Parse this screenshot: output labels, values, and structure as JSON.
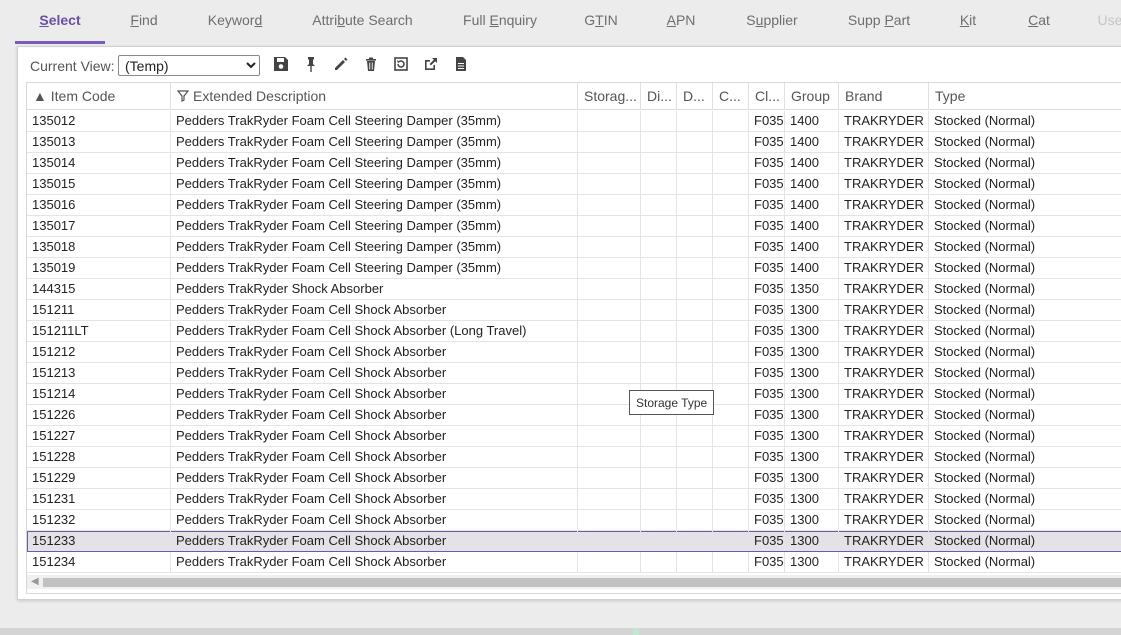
{
  "tabs": [
    {
      "pre": "",
      "acc": "S",
      "post": "elect"
    },
    {
      "pre": "",
      "acc": "F",
      "post": "ind"
    },
    {
      "pre": "Keywor",
      "acc": "d",
      "post": ""
    },
    {
      "pre": "Attri",
      "acc": "b",
      "post": "ute Search"
    },
    {
      "pre": "Full ",
      "acc": "E",
      "post": "nquiry"
    },
    {
      "pre": "G",
      "acc": "T",
      "post": "IN"
    },
    {
      "pre": "",
      "acc": "A",
      "post": "PN"
    },
    {
      "pre": "S",
      "acc": "u",
      "post": "pplier"
    },
    {
      "pre": "Supp ",
      "acc": "P",
      "post": "art"
    },
    {
      "pre": "",
      "acc": "K",
      "post": "it"
    },
    {
      "pre": "",
      "acc": "C",
      "post": "at"
    },
    {
      "pre": "Use",
      "acc": "",
      "post": ""
    }
  ],
  "toolbar": {
    "current_view_label": "Current View:",
    "current_view_value": "(Temp)",
    "icons": [
      "save-icon",
      "pin-icon",
      "edit-icon",
      "delete-icon",
      "reset-icon",
      "export-icon",
      "document-icon"
    ]
  },
  "grid": {
    "columns": [
      {
        "key": "code",
        "label": "Item Code",
        "prefix": "▲ "
      },
      {
        "key": "desc",
        "label": "Extended Description",
        "prefix": "filter"
      },
      {
        "key": "storage",
        "label": "Storag...",
        "prefix": ""
      },
      {
        "key": "di",
        "label": "Di...",
        "prefix": ""
      },
      {
        "key": "d",
        "label": "D...",
        "prefix": ""
      },
      {
        "key": "c",
        "label": "C...",
        "prefix": ""
      },
      {
        "key": "cl",
        "label": "Cl...",
        "prefix": ""
      },
      {
        "key": "group",
        "label": "Group",
        "prefix": ""
      },
      {
        "key": "brand",
        "label": "Brand",
        "prefix": ""
      },
      {
        "key": "type",
        "label": "Type",
        "prefix": ""
      }
    ],
    "rows": [
      {
        "code": "135012",
        "desc": "Pedders TrakRyder Foam Cell Steering Damper (35mm)",
        "cl": "F035",
        "group": "1400",
        "brand": "TRAKRYDER",
        "type": "Stocked (Normal)"
      },
      {
        "code": "135013",
        "desc": "Pedders TrakRyder Foam Cell Steering Damper (35mm)",
        "cl": "F035",
        "group": "1400",
        "brand": "TRAKRYDER",
        "type": "Stocked (Normal)"
      },
      {
        "code": "135014",
        "desc": "Pedders TrakRyder Foam Cell Steering Damper (35mm)",
        "cl": "F035",
        "group": "1400",
        "brand": "TRAKRYDER",
        "type": "Stocked (Normal)"
      },
      {
        "code": "135015",
        "desc": "Pedders TrakRyder Foam Cell Steering Damper (35mm)",
        "cl": "F035",
        "group": "1400",
        "brand": "TRAKRYDER",
        "type": "Stocked (Normal)"
      },
      {
        "code": "135016",
        "desc": "Pedders TrakRyder Foam Cell Steering Damper (35mm)",
        "cl": "F035",
        "group": "1400",
        "brand": "TRAKRYDER",
        "type": "Stocked (Normal)"
      },
      {
        "code": "135017",
        "desc": "Pedders TrakRyder Foam Cell Steering Damper (35mm)",
        "cl": "F035",
        "group": "1400",
        "brand": "TRAKRYDER",
        "type": "Stocked (Normal)"
      },
      {
        "code": "135018",
        "desc": "Pedders TrakRyder Foam Cell Steering Damper (35mm)",
        "cl": "F035",
        "group": "1400",
        "brand": "TRAKRYDER",
        "type": "Stocked (Normal)"
      },
      {
        "code": "135019",
        "desc": "Pedders TrakRyder Foam Cell Steering Damper (35mm)",
        "cl": "F035",
        "group": "1400",
        "brand": "TRAKRYDER",
        "type": "Stocked (Normal)"
      },
      {
        "code": "144315",
        "desc": "Pedders TrakRyder Shock Absorber",
        "cl": "F035",
        "group": "1350",
        "brand": "TRAKRYDER",
        "type": "Stocked (Normal)"
      },
      {
        "code": "151211",
        "desc": "Pedders TrakRyder Foam Cell Shock Absorber",
        "cl": "F035",
        "group": "1300",
        "brand": "TRAKRYDER",
        "type": "Stocked (Normal)"
      },
      {
        "code": "151211LT",
        "desc": "Pedders TrakRyder Foam Cell Shock Absorber (Long Travel)",
        "cl": "F035",
        "group": "1300",
        "brand": "TRAKRYDER",
        "type": "Stocked (Normal)"
      },
      {
        "code": "151212",
        "desc": "Pedders TrakRyder Foam Cell Shock Absorber",
        "cl": "F035",
        "group": "1300",
        "brand": "TRAKRYDER",
        "type": "Stocked (Normal)"
      },
      {
        "code": "151213",
        "desc": "Pedders TrakRyder Foam Cell Shock Absorber",
        "cl": "F035",
        "group": "1300",
        "brand": "TRAKRYDER",
        "type": "Stocked (Normal)"
      },
      {
        "code": "151214",
        "desc": "Pedders TrakRyder Foam Cell Shock Absorber",
        "cl": "F035",
        "group": "1300",
        "brand": "TRAKRYDER",
        "type": "Stocked (Normal)"
      },
      {
        "code": "151226",
        "desc": "Pedders TrakRyder Foam Cell Shock Absorber",
        "cl": "F035",
        "group": "1300",
        "brand": "TRAKRYDER",
        "type": "Stocked (Normal)"
      },
      {
        "code": "151227",
        "desc": "Pedders TrakRyder Foam Cell Shock Absorber",
        "cl": "F035",
        "group": "1300",
        "brand": "TRAKRYDER",
        "type": "Stocked (Normal)"
      },
      {
        "code": "151228",
        "desc": "Pedders TrakRyder Foam Cell Shock Absorber",
        "cl": "F035",
        "group": "1300",
        "brand": "TRAKRYDER",
        "type": "Stocked (Normal)"
      },
      {
        "code": "151229",
        "desc": "Pedders TrakRyder Foam Cell Shock Absorber",
        "cl": "F035",
        "group": "1300",
        "brand": "TRAKRYDER",
        "type": "Stocked (Normal)"
      },
      {
        "code": "151231",
        "desc": "Pedders TrakRyder Foam Cell Shock Absorber",
        "cl": "F035",
        "group": "1300",
        "brand": "TRAKRYDER",
        "type": "Stocked (Normal)"
      },
      {
        "code": "151232",
        "desc": "Pedders TrakRyder Foam Cell Shock Absorber",
        "cl": "F035",
        "group": "1300",
        "brand": "TRAKRYDER",
        "type": "Stocked (Normal)"
      },
      {
        "code": "151233",
        "desc": "Pedders TrakRyder Foam Cell Shock Absorber",
        "cl": "F035",
        "group": "1300",
        "brand": "TRAKRYDER",
        "type": "Stocked (Normal)",
        "selected": true
      },
      {
        "code": "151234",
        "desc": "Pedders TrakRyder Foam Cell Shock Absorber",
        "cl": "F035",
        "group": "1300",
        "brand": "TRAKRYDER",
        "type": "Stocked (Normal)"
      }
    ]
  },
  "tooltip": {
    "text": "Storage Type"
  },
  "colors": {
    "accent": "#7a5cc0",
    "selected_row": "#e4e2e6"
  }
}
